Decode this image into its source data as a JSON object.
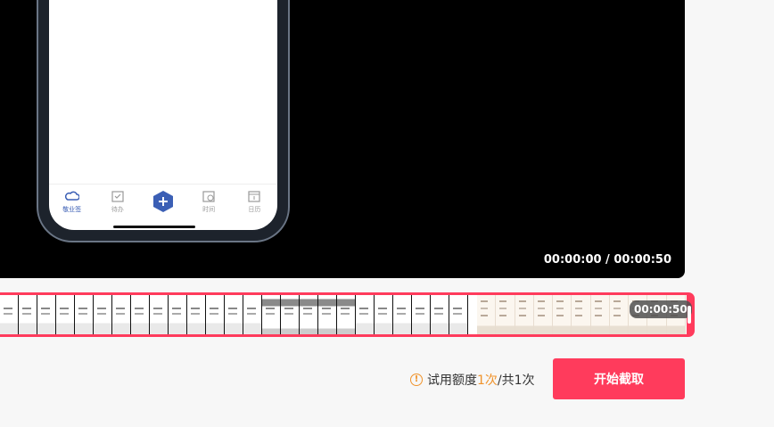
{
  "phone": {
    "tabs": [
      {
        "label": "敬业签",
        "icon": "cloud-icon",
        "active": true
      },
      {
        "label": "待办",
        "icon": "calendar-check-icon",
        "active": false
      },
      {
        "label": "",
        "icon": "plus-icon",
        "active": false
      },
      {
        "label": "时间",
        "icon": "clock-icon",
        "active": false
      },
      {
        "label": "日历",
        "icon": "calendar-icon",
        "active": false
      }
    ]
  },
  "player": {
    "time_display": "00:00:00 / 00:00:50"
  },
  "timeline": {
    "end_time": "00:00:50"
  },
  "quota": {
    "prefix": "试用额度 ",
    "used": "1次",
    "suffix": "/共1次"
  },
  "actions": {
    "start_label": "开始截取"
  },
  "colors": {
    "accent": "#ff3b5c",
    "warning": "#f0932b",
    "phone_accent": "#3b5fb5"
  }
}
